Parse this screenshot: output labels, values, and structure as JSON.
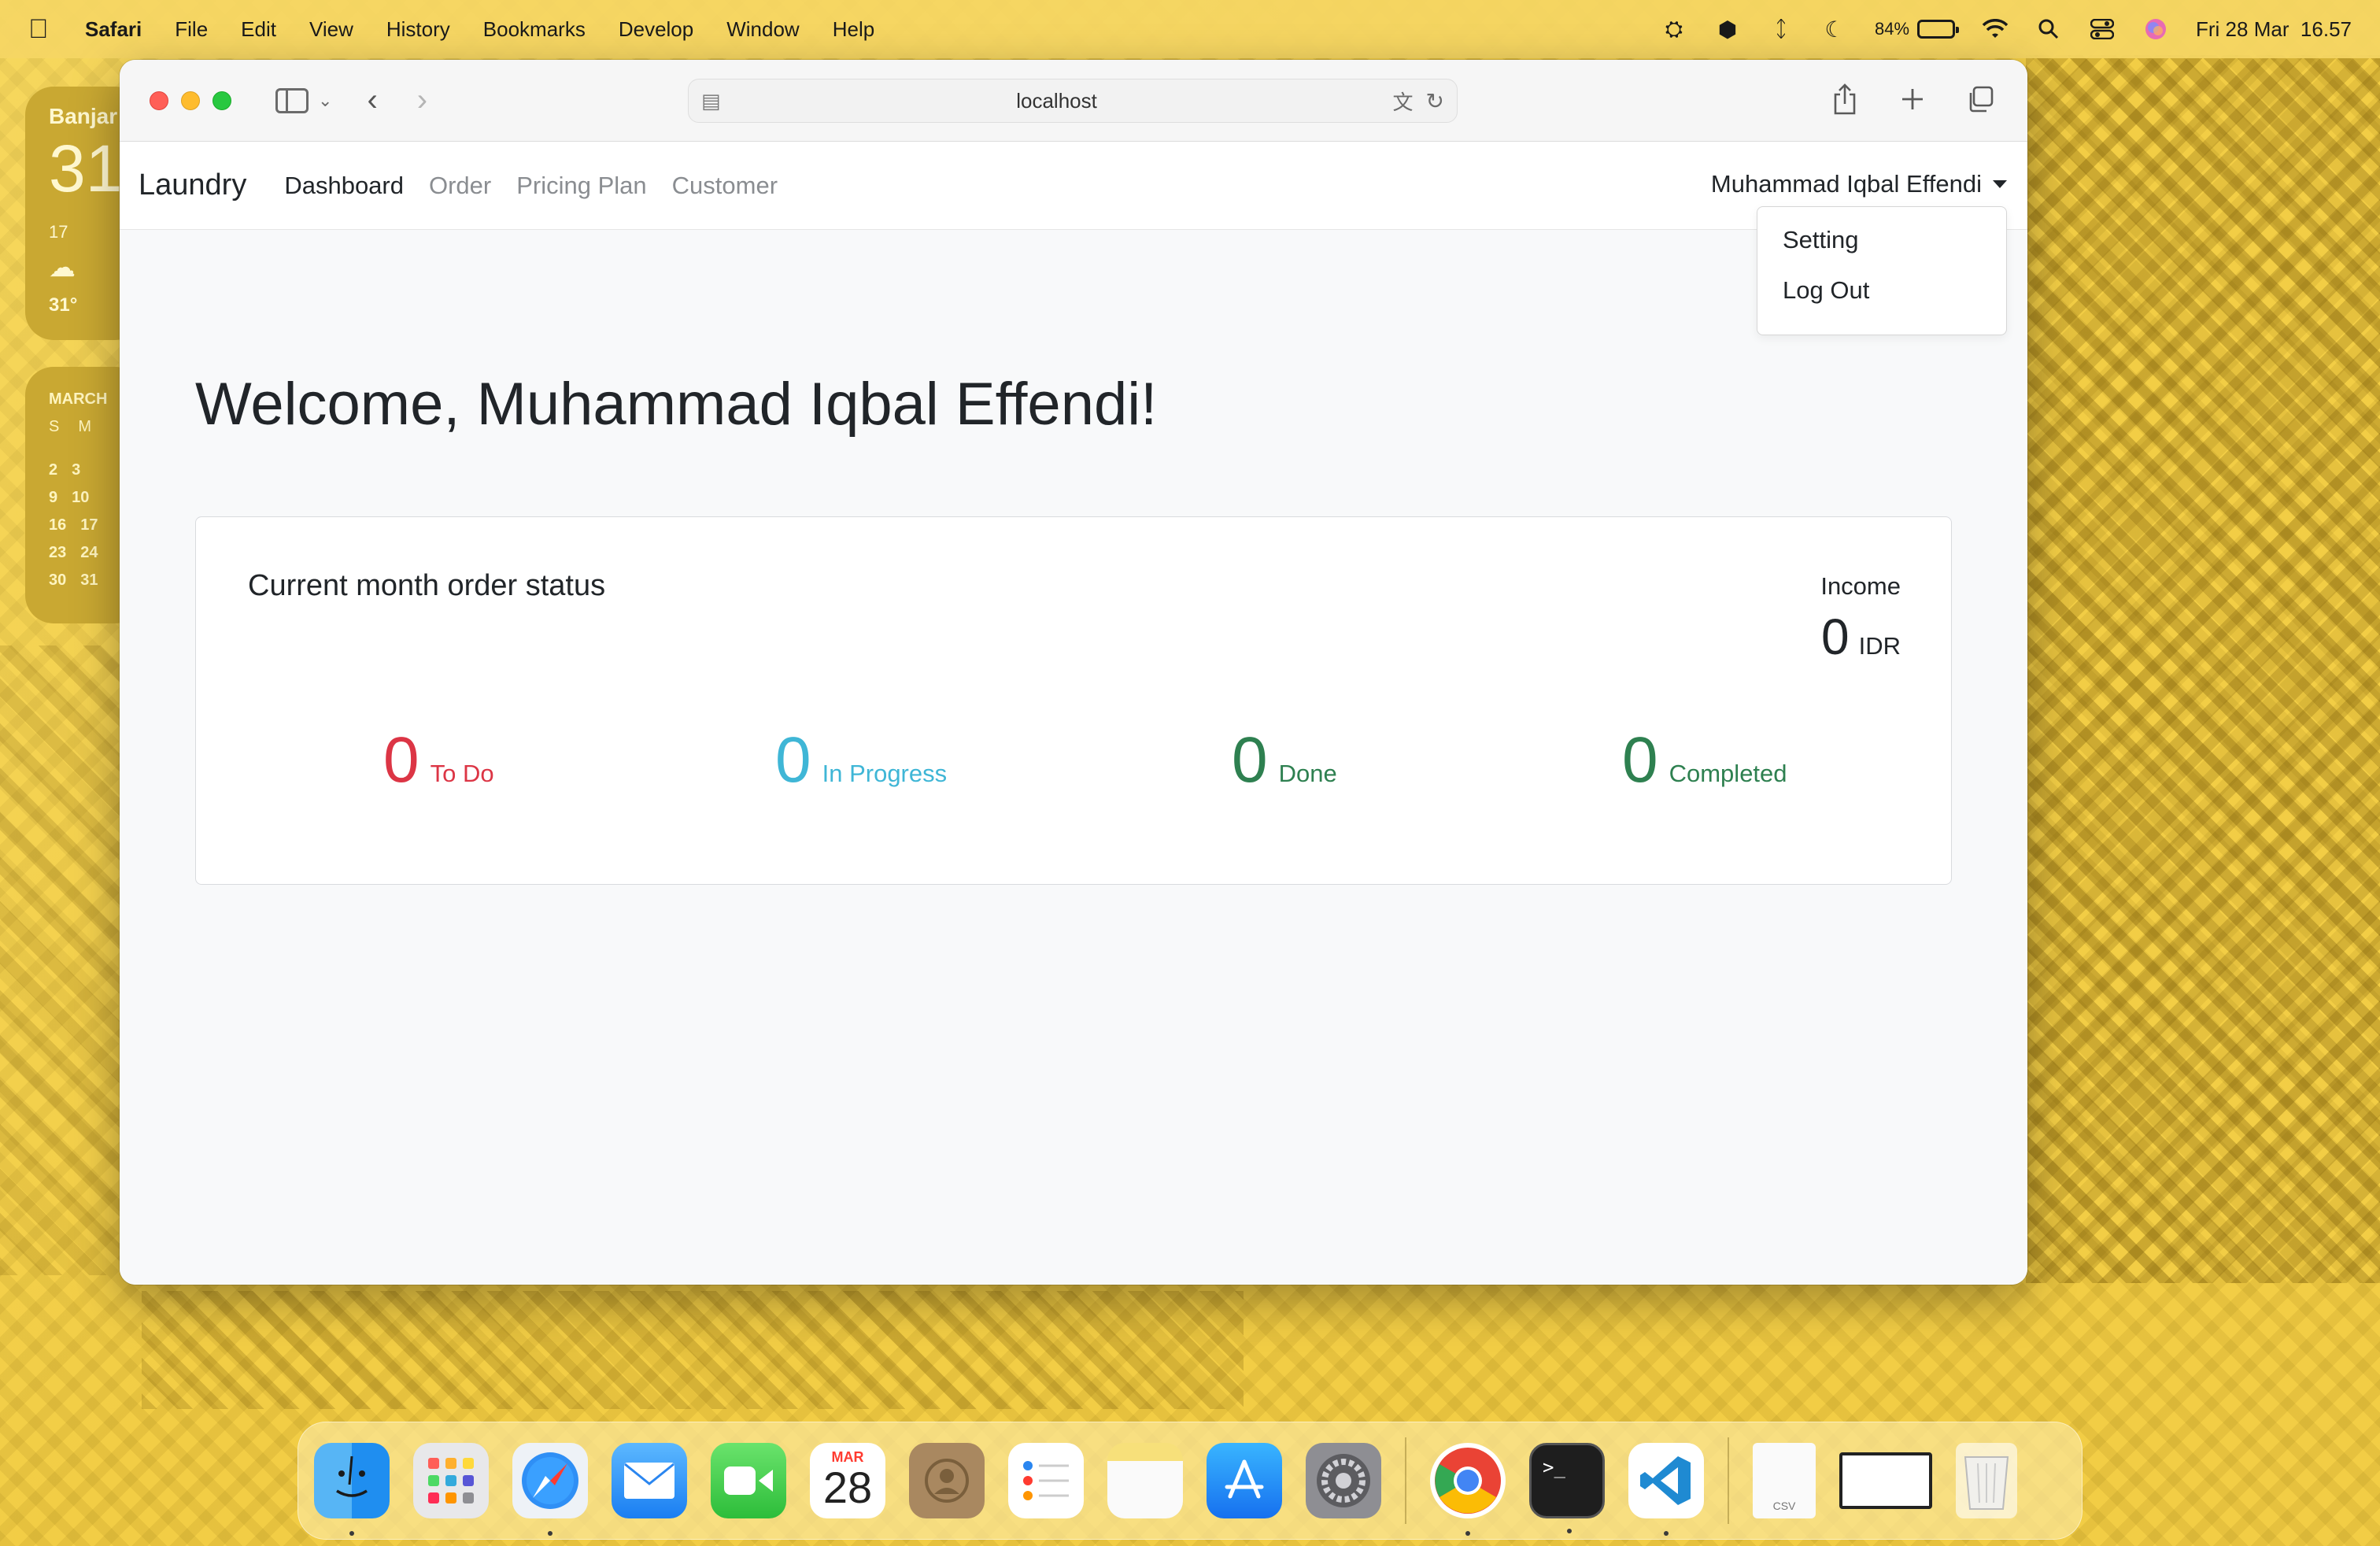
{
  "menubar": {
    "app_name": "Safari",
    "items": [
      "File",
      "Edit",
      "View",
      "History",
      "Bookmarks",
      "Develop",
      "Window",
      "Help"
    ],
    "battery_percent": "84%",
    "battery_level": 0.84,
    "datetime": "Fri 28 Mar  16.57"
  },
  "widgets": {
    "weather": {
      "city": "Banjar",
      "temperature": "31",
      "low": "17",
      "current": "31°"
    },
    "calendar": {
      "month": "MARCH",
      "dow": [
        "S",
        "M"
      ],
      "weeks": [
        [
          "2",
          "3"
        ],
        [
          "9",
          "10"
        ],
        [
          "16",
          "17"
        ],
        [
          "23",
          "24"
        ],
        [
          "30",
          "31"
        ]
      ]
    }
  },
  "browser": {
    "url": "localhost"
  },
  "navbar": {
    "brand": "Laundry",
    "links": [
      "Dashboard",
      "Order",
      "Pricing Plan",
      "Customer"
    ],
    "user": "Muhammad Iqbal Effendi"
  },
  "dropdown": {
    "items": [
      "Setting",
      "Log Out"
    ]
  },
  "main": {
    "welcome": "Welcome, Muhammad Iqbal Effendi!",
    "card": {
      "title": "Current month order status",
      "income_label": "Income",
      "income_value": "0",
      "income_unit": "IDR",
      "stats": [
        {
          "value": "0",
          "label": "To Do",
          "color": "#dc3545"
        },
        {
          "value": "0",
          "label": "In Progress",
          "color": "#3fb6d6"
        },
        {
          "value": "0",
          "label": "Done",
          "color": "#2e8050"
        },
        {
          "value": "0",
          "label": "Completed",
          "color": "#2e8050"
        }
      ]
    }
  },
  "dock": {
    "calendar_month": "MAR",
    "calendar_day": "28",
    "csv_label": "CSV",
    "icons": [
      "finder-icon",
      "launchpad-icon",
      "safari-icon",
      "mail-icon",
      "facetime-icon",
      "calendar-icon",
      "contacts-icon",
      "reminders-icon",
      "notes-icon",
      "app-store-icon",
      "system-settings-icon",
      "chrome-icon",
      "terminal-icon",
      "vscode-icon",
      "csv-file-icon",
      "window-thumbnail-icon",
      "trash-icon"
    ]
  }
}
